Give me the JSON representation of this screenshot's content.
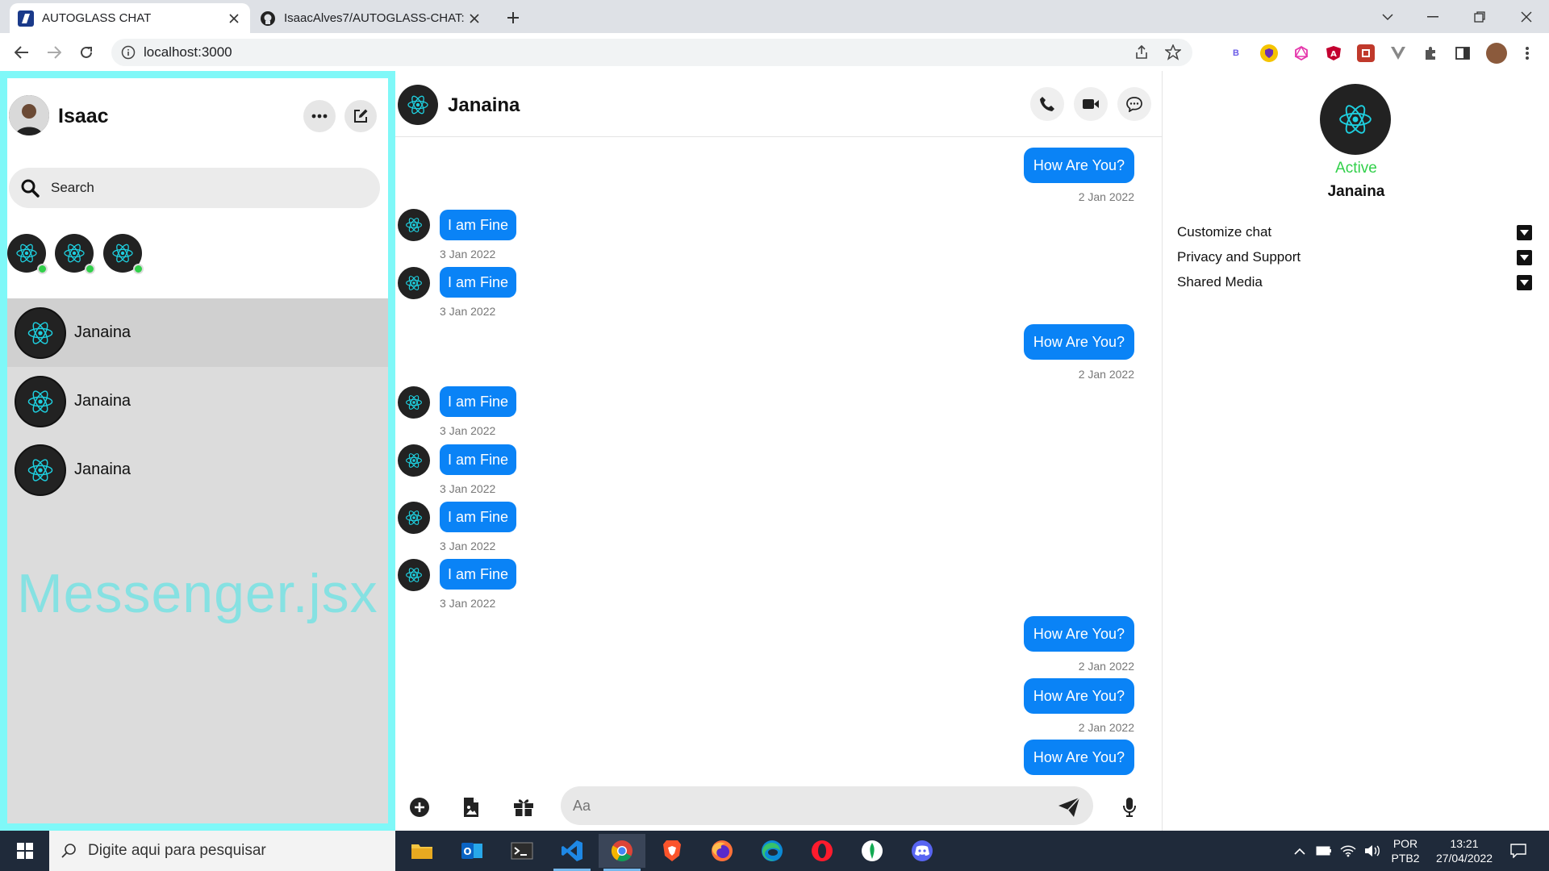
{
  "browser": {
    "tabs": [
      {
        "title": "AUTOGLASS CHAT",
        "active": true
      },
      {
        "title": "IsaacAlves7/AUTOGLASS-CHAT: ",
        "active": false
      }
    ],
    "url": "localhost:3000"
  },
  "sidebar": {
    "user_name": "Isaac",
    "search_placeholder": "Search",
    "conversations": [
      {
        "name": "Janaina",
        "selected": true
      },
      {
        "name": "Janaina",
        "selected": false
      },
      {
        "name": "Janaina",
        "selected": false
      }
    ],
    "watermark": "Messenger.jsx"
  },
  "chat": {
    "contact_name": "Janaina",
    "messages": [
      {
        "direction": "out",
        "text": "How Are You?",
        "date": "2 Jan 2022"
      },
      {
        "direction": "in",
        "text": "I am Fine",
        "date": "3 Jan 2022"
      },
      {
        "direction": "in",
        "text": "I am Fine",
        "date": "3 Jan 2022"
      },
      {
        "direction": "out",
        "text": "How Are You?",
        "date": "2 Jan 2022"
      },
      {
        "direction": "in",
        "text": "I am Fine",
        "date": "3 Jan 2022"
      },
      {
        "direction": "in",
        "text": "I am Fine",
        "date": "3 Jan 2022"
      },
      {
        "direction": "in",
        "text": "I am Fine",
        "date": "3 Jan 2022"
      },
      {
        "direction": "in",
        "text": "I am Fine",
        "date": "3 Jan 2022"
      },
      {
        "direction": "out",
        "text": "How Are You?",
        "date": "2 Jan 2022"
      },
      {
        "direction": "out",
        "text": "How Are You?",
        "date": "2 Jan 2022"
      },
      {
        "direction": "out",
        "text": "How Are You?",
        "date": ""
      }
    ],
    "input_placeholder": "Aa"
  },
  "right_panel": {
    "status": "Active",
    "name": "Janaina",
    "menu": [
      "Customize chat",
      "Privacy and Support",
      "Shared Media"
    ]
  },
  "taskbar": {
    "search_placeholder": "Digite aqui para pesquisar",
    "lang_top": "POR",
    "lang_bottom": "PTB2",
    "time": "13:21",
    "date": "27/04/2022"
  },
  "colors": {
    "accent": "#0a83f6",
    "sidebar_border": "#7ff8f8",
    "active_green": "#31d04a",
    "react_cyan": "#1ed0e0"
  }
}
